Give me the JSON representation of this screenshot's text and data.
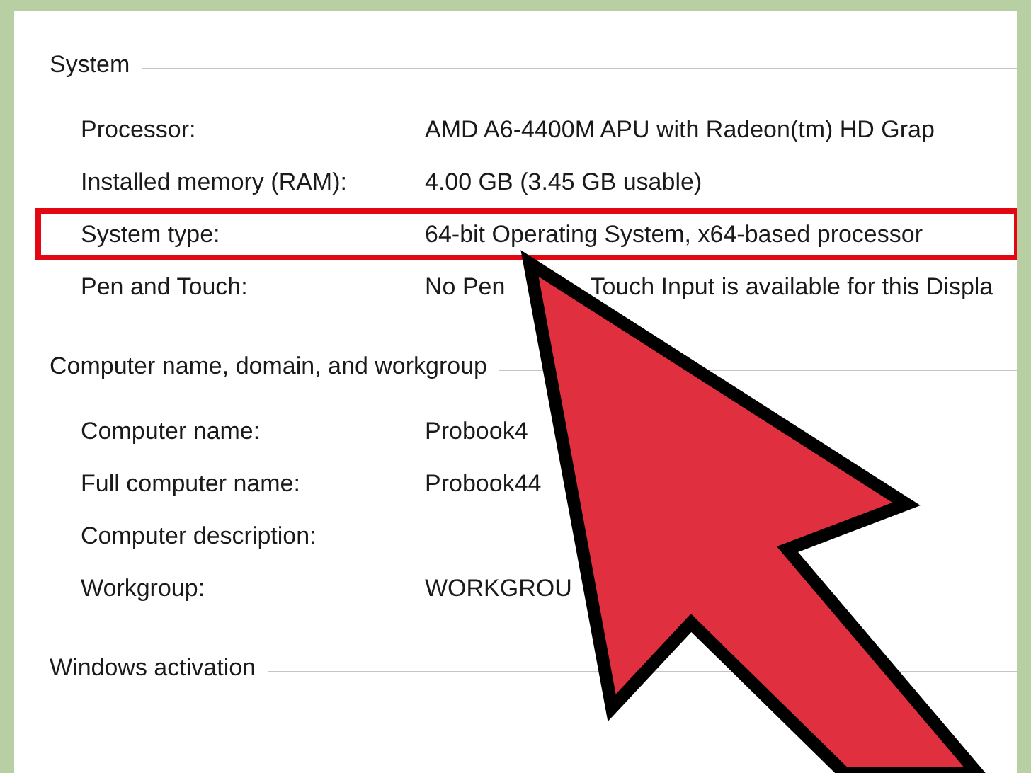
{
  "sections": [
    {
      "heading": "System",
      "rows": [
        {
          "label": "Processor:",
          "value": [
            "AMD A6-4400M APU with Radeon(tm) HD Grap"
          ],
          "highlighted": false
        },
        {
          "label": "Installed memory (RAM):",
          "value": [
            "4.00 GB (3.45 GB usable)"
          ],
          "highlighted": false
        },
        {
          "label": "System type:",
          "value": [
            "64-bit Operating System, x64-based processor"
          ],
          "highlighted": true
        },
        {
          "label": "Pen and Touch:",
          "value": [
            "No Pen",
            "Touch Input is available for this Displa"
          ],
          "highlighted": false
        }
      ]
    },
    {
      "heading": "Computer name, domain, and workgroup",
      "rows": [
        {
          "label": "Computer name:",
          "value": [
            "Probook4"
          ],
          "highlighted": false
        },
        {
          "label": "Full computer name:",
          "value": [
            "Probook44"
          ],
          "highlighted": false
        },
        {
          "label": "Computer description:",
          "highlighted": false
        },
        {
          "label": "Workgroup:",
          "value": [
            "WORKGROU"
          ],
          "highlighted": false
        }
      ]
    },
    {
      "heading": "Windows activation"
    }
  ]
}
